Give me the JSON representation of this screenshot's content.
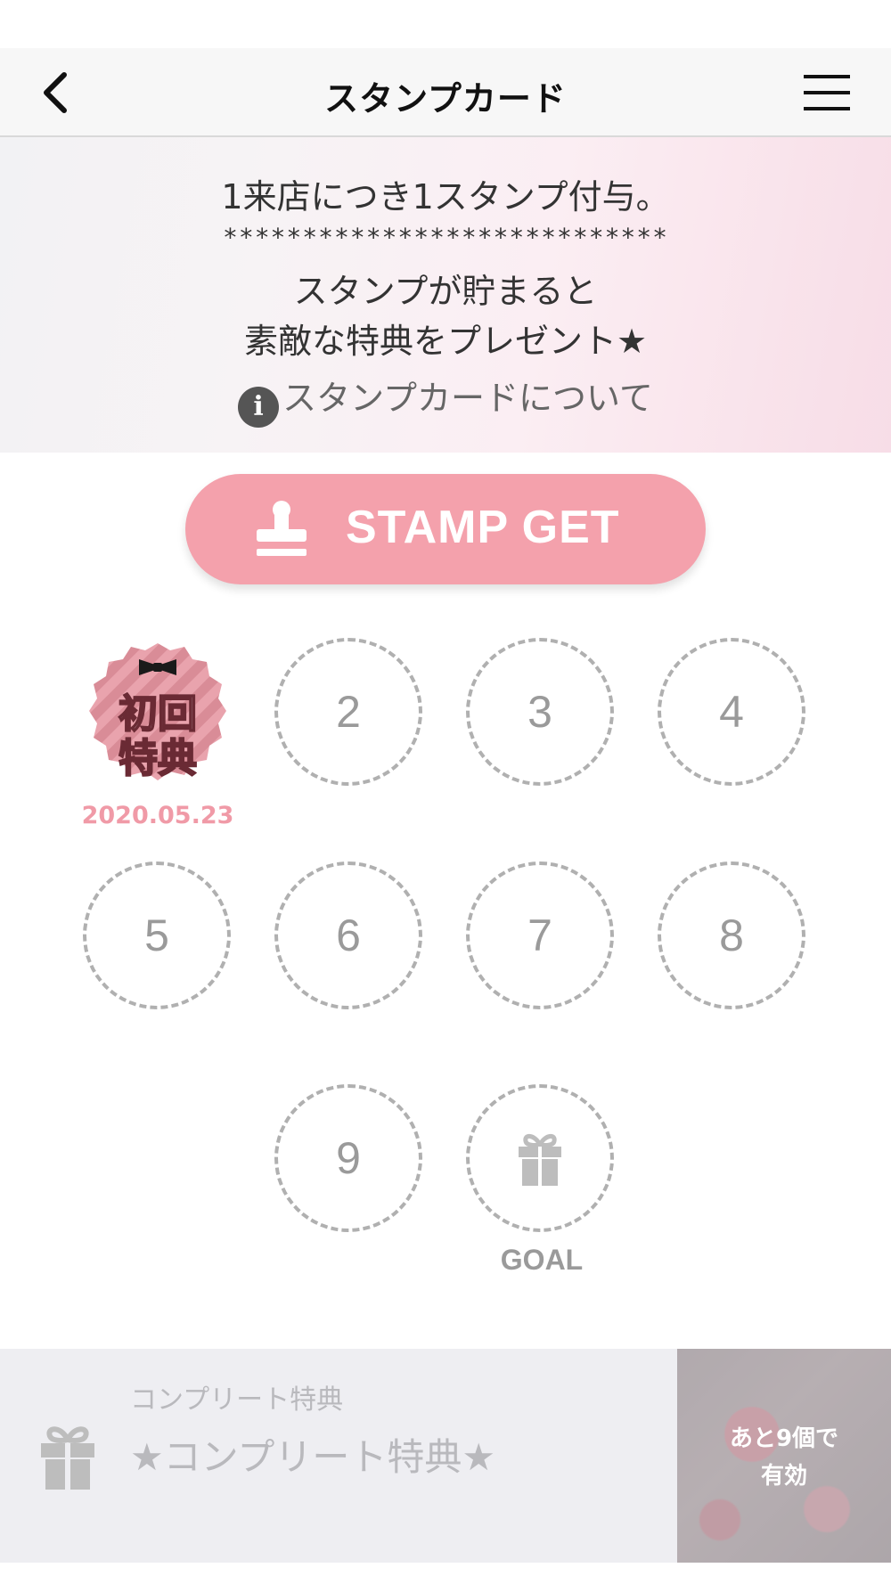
{
  "header": {
    "title": "スタンプカード"
  },
  "banner": {
    "line1": "1来店につき1スタンプ付与。",
    "stars": "****************************",
    "line2": "スタンプが貯まると",
    "line3": "素敵な特典をプレゼント★",
    "about_link": "スタンプカードについて"
  },
  "stamp_button": {
    "label": "STAMP GET"
  },
  "stamps": {
    "first": {
      "text_line1": "初回",
      "text_line2": "特典",
      "date": "2020.05.23"
    },
    "slots": [
      "2",
      "3",
      "4",
      "5",
      "6",
      "7",
      "8",
      "9"
    ],
    "goal_label": "GOAL"
  },
  "complete": {
    "subtitle": "コンプリート特典",
    "title": "★コンプリート特典★",
    "remaining_line1": "あと9個で",
    "remaining_line2": "有効"
  },
  "colors": {
    "accent": "#f4a1ac",
    "date": "#f09aa7",
    "slot_border": "#b0b0b0"
  }
}
